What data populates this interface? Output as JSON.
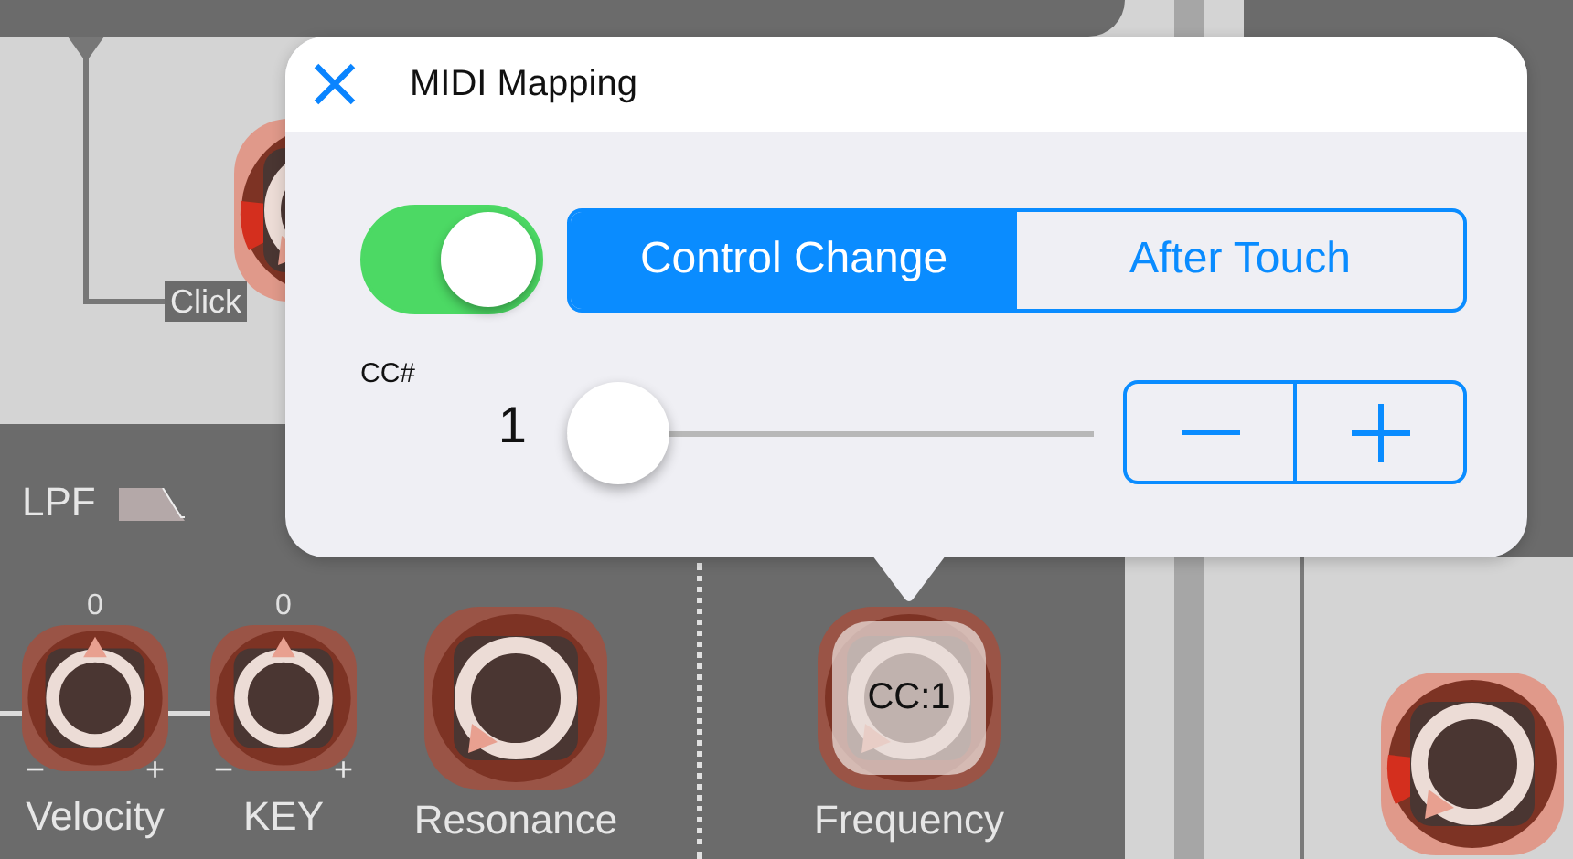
{
  "panel": {
    "click_label": "Click",
    "filter_label": "LPF"
  },
  "knobs": [
    {
      "kind": "accent"
    },
    {
      "kind": "bipolar",
      "value": "0",
      "minus": "−",
      "plus": "+",
      "label": "Velocity"
    },
    {
      "kind": "bipolar",
      "value": "0",
      "minus": "−",
      "plus": "+",
      "label": "KEY"
    },
    {
      "kind": "plain",
      "label": "Resonance"
    },
    {
      "kind": "mapped",
      "badge": "CC:1",
      "label": "Frequency"
    },
    {
      "kind": "accent"
    }
  ],
  "popover": {
    "title": "MIDI Mapping",
    "enabled": true,
    "segments": [
      {
        "label": "Control Change",
        "selected": true
      },
      {
        "label": "After Touch",
        "selected": false
      }
    ],
    "cc": {
      "label": "CC#",
      "value": "1",
      "level": 0
    }
  }
}
